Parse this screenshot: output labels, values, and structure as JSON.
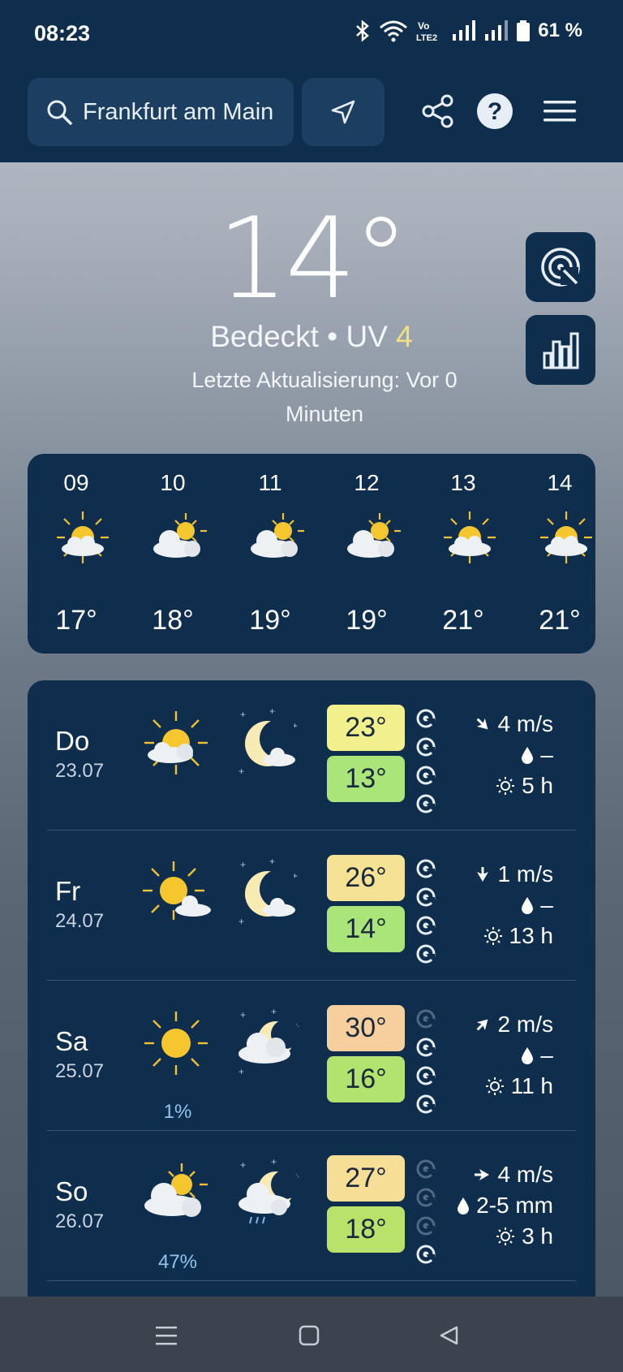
{
  "status_bar": {
    "time": "08:23",
    "volte": "Vo\nLTE2",
    "battery": "61 %"
  },
  "header": {
    "search_value": "Frankfurt am Main",
    "icons": [
      "search-icon",
      "location-arrow-icon",
      "share-icon",
      "help-icon",
      "menu-icon"
    ]
  },
  "current": {
    "temperature": "14°",
    "condition": "Bedeckt",
    "separator": "•",
    "uv_label": "UV",
    "uv_value": "4",
    "updated": "Letzte Aktualisierung: Vor 0 Minuten"
  },
  "hourly": [
    {
      "hour": "09",
      "temp": "17°",
      "icon": "sun-cloud-icon"
    },
    {
      "hour": "10",
      "temp": "18°",
      "icon": "cloud-sun-icon"
    },
    {
      "hour": "11",
      "temp": "19°",
      "icon": "cloud-sun-icon"
    },
    {
      "hour": "12",
      "temp": "19°",
      "icon": "cloud-sun-icon"
    },
    {
      "hour": "13",
      "temp": "21°",
      "icon": "sun-cloud-icon"
    },
    {
      "hour": "14",
      "temp": "21°",
      "icon": "sun-cloud-icon"
    }
  ],
  "daily": [
    {
      "day": "Do",
      "date": "23.07",
      "max": "23°",
      "min": "13°",
      "wind": "4 m/s",
      "rain": "–",
      "sun": "5 h",
      "precip_prob": "",
      "day_icon": "sun-cloud-icon",
      "night_icon": "moon-cloud-icon"
    },
    {
      "day": "Fr",
      "date": "24.07",
      "max": "26°",
      "min": "14°",
      "wind": "1 m/s",
      "rain": "–",
      "sun": "13 h",
      "precip_prob": "",
      "day_icon": "sun-small-cloud-icon",
      "night_icon": "moon-cloud-icon"
    },
    {
      "day": "Sa",
      "date": "25.07",
      "max": "30°",
      "min": "16°",
      "wind": "2 m/s",
      "rain": "–",
      "sun": "11 h",
      "precip_prob": "1%",
      "day_icon": "sun-icon",
      "night_icon": "cloud-moon-icon"
    },
    {
      "day": "So",
      "date": "26.07",
      "max": "27°",
      "min": "18°",
      "wind": "4 m/s",
      "rain": "2-5 mm",
      "sun": "3 h",
      "precip_prob": "47%",
      "day_icon": "cloud-sun-icon",
      "night_icon": "cloud-moon-rain-icon"
    }
  ],
  "colors": {
    "header_bg": "#0f2d4d",
    "panel_bg": "#0f2d4d",
    "uv_accent": "#f2e07a",
    "precip_text": "#8fc6ec"
  }
}
